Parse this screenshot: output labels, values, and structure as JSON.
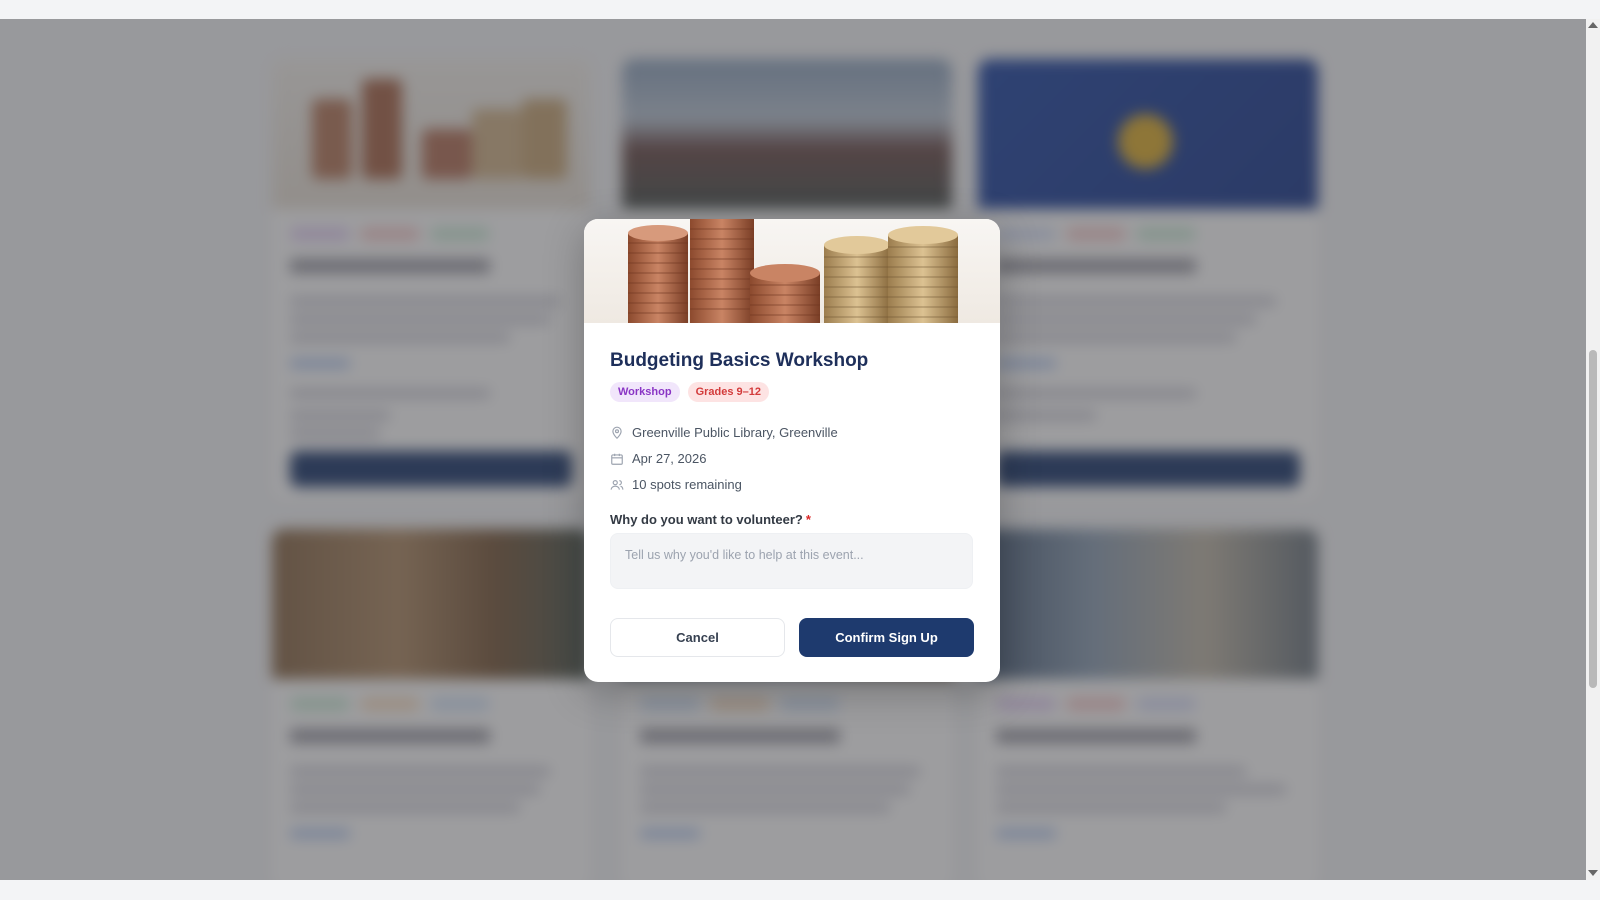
{
  "modal": {
    "title": "Budgeting Basics Workshop",
    "tags": [
      {
        "label": "Workshop",
        "color": "#8a35c5"
      },
      {
        "label": "Grades 9–12",
        "color": "#d33b3b"
      }
    ],
    "location": "Greenville Public Library, Greenville",
    "date": "Apr 27, 2026",
    "spots": "10 spots remaining",
    "question_label": "Why do you want to volunteer?",
    "required_marker": "*",
    "answer_value": "",
    "answer_placeholder": "Tell us why you'd like to help at this event...",
    "cancel_label": "Cancel",
    "confirm_label": "Confirm Sign Up",
    "icons": {
      "location": "map-pin-icon",
      "date": "calendar-icon",
      "spots": "users-icon"
    }
  },
  "colors": {
    "primary": "#1e3a6e",
    "title": "#1e2f5a",
    "required": "#dc2626"
  }
}
